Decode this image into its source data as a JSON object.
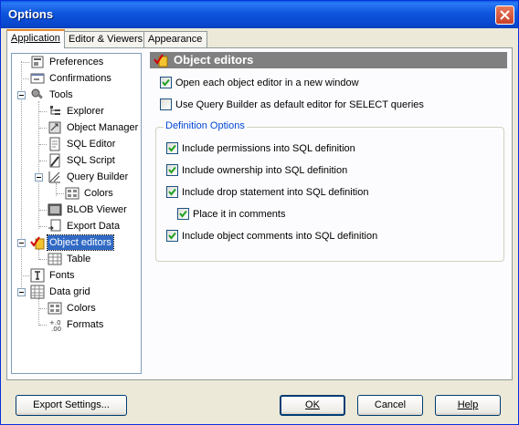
{
  "window": {
    "title": "Options"
  },
  "tabs": [
    {
      "label": "Application",
      "active": true
    },
    {
      "label": "Editor & Viewers",
      "active": false
    },
    {
      "label": "Appearance",
      "active": false
    }
  ],
  "tree": {
    "items": [
      {
        "label": "Preferences",
        "icon": "preferences-icon"
      },
      {
        "label": "Confirmations",
        "icon": "confirmations-icon"
      },
      {
        "label": "Tools",
        "icon": "tools-icon"
      },
      {
        "label": "Explorer",
        "icon": "explorer-icon"
      },
      {
        "label": "Object Manager",
        "icon": "object-manager-icon"
      },
      {
        "label": "SQL Editor",
        "icon": "sql-editor-icon"
      },
      {
        "label": "SQL Script",
        "icon": "sql-script-icon"
      },
      {
        "label": "Query Builder",
        "icon": "query-builder-icon"
      },
      {
        "label": "Colors",
        "icon": "colors-icon"
      },
      {
        "label": "BLOB Viewer",
        "icon": "blob-viewer-icon"
      },
      {
        "label": "Export Data",
        "icon": "export-data-icon"
      },
      {
        "label": "Object editors",
        "icon": "object-editors-icon",
        "selected": true
      },
      {
        "label": "Table",
        "icon": "table-icon"
      },
      {
        "label": "Fonts",
        "icon": "fonts-icon"
      },
      {
        "label": "Data grid",
        "icon": "data-grid-icon"
      },
      {
        "label": "Colors",
        "icon": "colors-icon"
      },
      {
        "label": "Formats",
        "icon": "formats-icon"
      }
    ]
  },
  "panel": {
    "title": "Object editors",
    "options": [
      {
        "label": "Open each object editor in a new window",
        "checked": true
      },
      {
        "label": "Use Query Builder as default editor for SELECT queries",
        "checked": false
      }
    ],
    "definition": {
      "title": "Definition Options",
      "options": [
        {
          "label": "Include permissions into SQL definition",
          "checked": true
        },
        {
          "label": "Include ownership into SQL definition",
          "checked": true
        },
        {
          "label": "Include drop statement into SQL definition",
          "checked": true
        },
        {
          "label": "Place it in comments",
          "checked": true
        },
        {
          "label": "Include object comments into SQL definition",
          "checked": true
        }
      ]
    }
  },
  "buttons": {
    "export": "Export Settings...",
    "ok": "OK",
    "cancel": "Cancel",
    "help": "Help"
  },
  "colors": {
    "titlebar": "#0a5fe8",
    "selection": "#316ac5",
    "group_title": "#0046d5",
    "header": "#808080"
  }
}
